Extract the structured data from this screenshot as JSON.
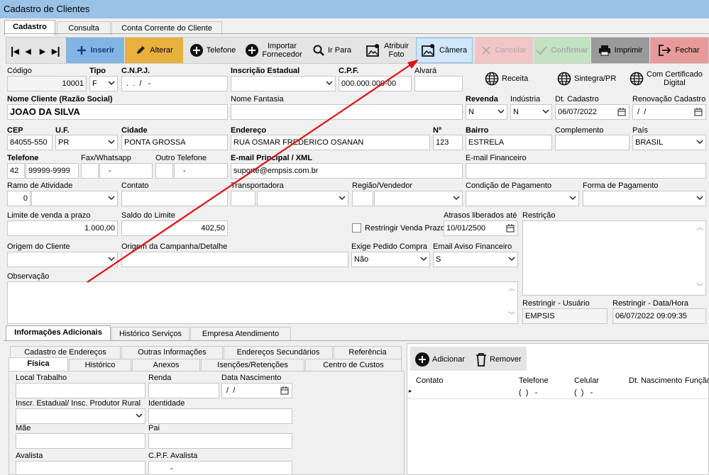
{
  "window": {
    "title": "Cadastro de Clientes"
  },
  "main_tabs": [
    "Cadastro",
    "Consulta",
    "Conta Corrente do Cliente"
  ],
  "toolbar": {
    "inserir": "Inserir",
    "alterar": "Alterar",
    "telefone": "Telefone",
    "importar": "Importar\nFornecedor",
    "ir_para": "Ir Para",
    "atribuir": "Atribuir\nFoto",
    "camera": "Câmera",
    "cancelar": "Cancelar",
    "confirmar": "Confirmar",
    "imprimir": "Imprimir",
    "fechar": "Fechar",
    "colors": {
      "inserir": "#82b4e6",
      "alterar": "#e8b03c",
      "camera": "#cfe6fb",
      "cancelar": "#f2c6c6",
      "confirmar": "#c2e2c2",
      "imprimir": "#9a9a9a",
      "fechar": "#e89a9a"
    }
  },
  "labels": {
    "codigo": "Código",
    "tipo": "Tipo",
    "cnpj": "C.N.P.J.",
    "ie": "Inscrição Estadual",
    "cpf": "C.P.F.",
    "alvara": "Alvará",
    "receita": "Receita",
    "sintegra": "Sintegra/PR",
    "certificado": "Com Certificado\nDigital",
    "nome": "Nome Cliente (Razão Social)",
    "fantasia": "Nome Fantasia",
    "revenda": "Revenda",
    "industria": "Indústria",
    "dt_cadastro": "Dt. Cadastro",
    "renovacao": "Renovação Cadastro",
    "cep": "CEP",
    "uf": "U.F.",
    "cidade": "Cidade",
    "endereco": "Endereço",
    "numero": "Nº",
    "bairro": "Bairro",
    "complemento": "Complemento",
    "pais": "País",
    "telefone": "Telefone",
    "fax": "Fax/Whatsapp",
    "outro_tel": "Outro Telefone",
    "email": "E-mail Principal / XML",
    "email_fin": "E-mail Financeiro",
    "ramo": "Ramo de Atividade",
    "contato": "Contato",
    "transportadora": "Transportadora",
    "regiao": "Região/Vendedor",
    "cond_pag": "Condição de Pagamento",
    "forma_pag": "Forma de Pagamento",
    "limite": "Limite de venda a prazo",
    "saldo": "Saldo do Limite",
    "atrasos": "Atrasos liberados até",
    "restricao": "Restrição",
    "restringir_venda": "Restringir Venda Prazo",
    "origem": "Origem do Cliente",
    "campanha": "Origem da Campanha/Detalhe",
    "exige_pedido": "Exige Pedido Compra",
    "email_aviso": "Email Aviso Financeiro",
    "observacao": "Observação",
    "restringir_usuario": "Restringir - Usuário",
    "restringir_data": "Restringir - Data/Hora"
  },
  "values": {
    "codigo": "10001",
    "tipo": "F",
    "cnpj": " .  .  /   -",
    "cpf": "000.000.000-00",
    "nome": "JOAO DA SILVA",
    "revenda": "N",
    "industria": "N",
    "dt_cadastro": "06/07/2022",
    "renovacao": " /  /",
    "cep": "84055-550",
    "uf": "PR",
    "cidade": "PONTA GROSSA",
    "endereco": "RUA OSMAR FREDERICO OSANAN",
    "numero": "123",
    "bairro": "ESTRELA",
    "pais": "BRASIL",
    "tel_ddd": "42",
    "tel_num": "99999-9999",
    "fax": "-",
    "outro_tel": "-",
    "email": "suporte@empsis.com.br",
    "ramo": "0",
    "limite": "1.000,00",
    "saldo": "402,50",
    "atrasos": "10/01/2500",
    "exige_pedido": "Não",
    "email_aviso": "S",
    "restringir_usuario": "EMPSIS",
    "restringir_data": "06/07/2022 09:09:35"
  },
  "bottom_tabs": [
    "Informações Adicionais",
    "Histórico Serviços",
    "Empresa Atendimento"
  ],
  "inner_tabs_row1": [
    "Cadastro de Endereços",
    "Outras Informações",
    "Endereços Secundários",
    "Referência"
  ],
  "inner_tabs_row2": [
    "Física",
    "Histórico",
    "Anexos",
    "Isenções/Retenções",
    "Centro de Custos"
  ],
  "fisica": {
    "local_trabalho": "Local Trabalho",
    "renda": "Renda",
    "data_nasc": "Data Nascimento",
    "data_nasc_val": " /  /",
    "inscr": "Inscr. Estadual/ Insc. Produtor Rural",
    "identidade": "Identidade",
    "mae": "Mãe",
    "pai": "Pai",
    "avalista": "Avalista",
    "cpf_avalista": "C.P.F. Avalista",
    "cpf_avalista_val": "-"
  },
  "contacts": {
    "adicionar": "Adicionar",
    "remover": "Remover",
    "columns": [
      "Contato",
      "Telefone",
      "Celular",
      "Dt. Nascimento",
      "Função"
    ],
    "row": {
      "telefone": "(  )   -",
      "celular": "(  )   -"
    }
  }
}
